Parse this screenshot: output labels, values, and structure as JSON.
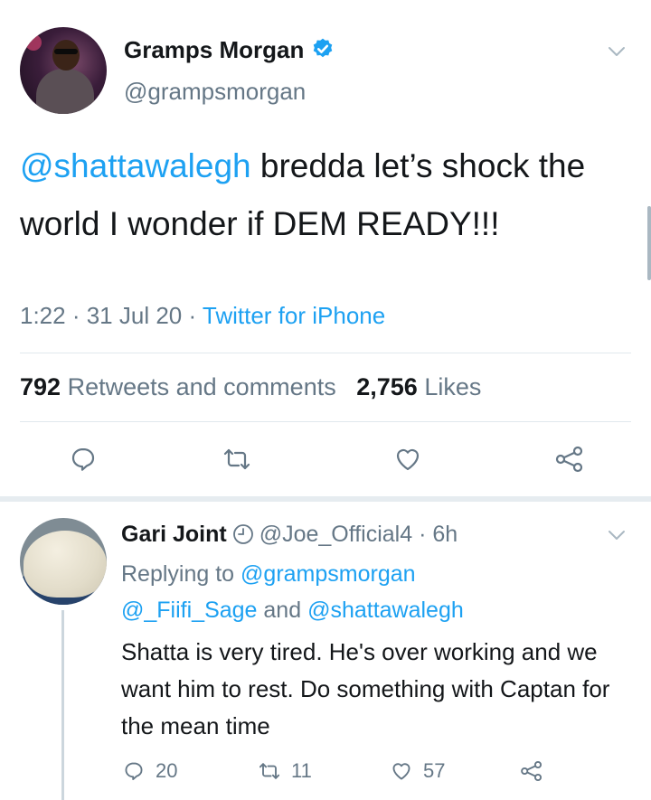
{
  "main_tweet": {
    "author_name": "Gramps Morgan",
    "handle": "@grampsmorgan",
    "text_mention": "@shattawalegh",
    "text_body": " bredda let’s shock the world I wonder if DEM READY!!!",
    "time": "1:22",
    "date": "31 Jul 20",
    "source": "Twitter for iPhone",
    "retweets_count": "792",
    "retweets_label": "Retweets and comments",
    "likes_count": "2,756",
    "likes_label": "Likes"
  },
  "reply": {
    "author_name": "Gari Joint",
    "handle": "@Joe_Official4",
    "time_ago": "6h",
    "replying_prefix": "Replying to ",
    "replying_to_1": "@grampsmorgan",
    "replying_to_2": "@_Fiifi_Sage",
    "replying_and": " and ",
    "replying_to_3": "@shattawalegh",
    "text": "Shatta is very tired. He's over working and we want him to rest. Do something with Captan for the mean time",
    "reply_count": "20",
    "retweet_count": "11",
    "like_count": "57"
  },
  "icons": {
    "verified": "verified-badge-icon",
    "chevron": "chevron-down-icon",
    "reply": "reply-icon",
    "retweet": "retweet-icon",
    "like": "heart-icon",
    "share": "share-icon",
    "clock": "clock-icon"
  },
  "colors": {
    "accent": "#1da1f2",
    "muted": "#657786",
    "text": "#14171a",
    "divider": "#e1e8ed"
  }
}
